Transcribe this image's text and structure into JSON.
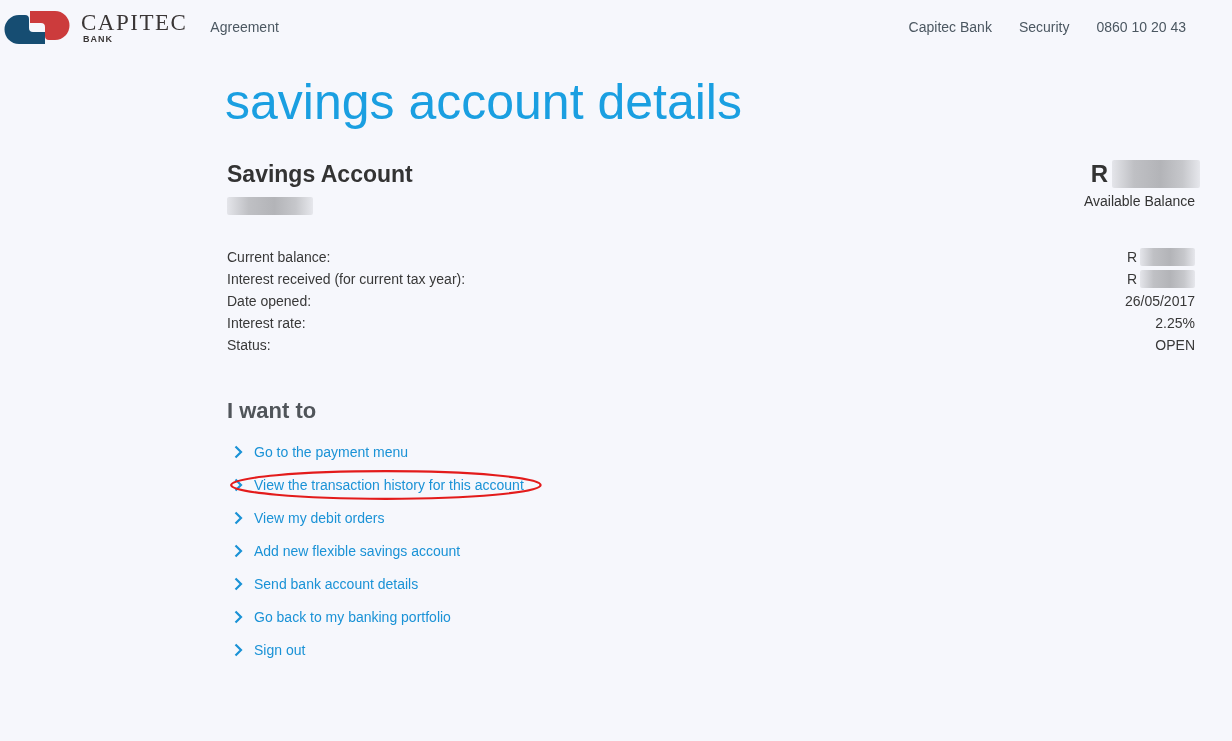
{
  "header": {
    "logo": {
      "wordmark": "CAPITEC",
      "subtitle": "BANK"
    },
    "nav_left": [
      {
        "label": "Agreement"
      }
    ],
    "nav_right": [
      {
        "label": "Capitec Bank"
      },
      {
        "label": "Security"
      },
      {
        "label": "0860 10 20 43"
      }
    ]
  },
  "page_title": "savings account details",
  "account": {
    "name": "Savings Account",
    "number_redacted": true,
    "currency_symbol": "R",
    "balance_redacted": true,
    "balance_label": "Available Balance"
  },
  "details": [
    {
      "label": "Current balance:",
      "value": "R",
      "redacted": true
    },
    {
      "label": "Interest received (for current tax year):",
      "value": "R",
      "redacted": true
    },
    {
      "label": "Date opened:",
      "value": "26/05/2017",
      "redacted": false
    },
    {
      "label": "Interest rate:",
      "value": "2.25%",
      "redacted": false
    },
    {
      "label": "Status:",
      "value": "OPEN",
      "redacted": false
    }
  ],
  "actions": {
    "heading": "I want to",
    "items": [
      {
        "label": "Go to the payment menu",
        "circled": false
      },
      {
        "label": "View the transaction history for this account",
        "circled": true
      },
      {
        "label": "View my debit orders",
        "circled": false
      },
      {
        "label": "Add new flexible savings account",
        "circled": false
      },
      {
        "label": "Send bank account details",
        "circled": false
      },
      {
        "label": "Go back to my banking portfolio",
        "circled": false
      },
      {
        "label": "Sign out",
        "circled": false
      }
    ]
  }
}
